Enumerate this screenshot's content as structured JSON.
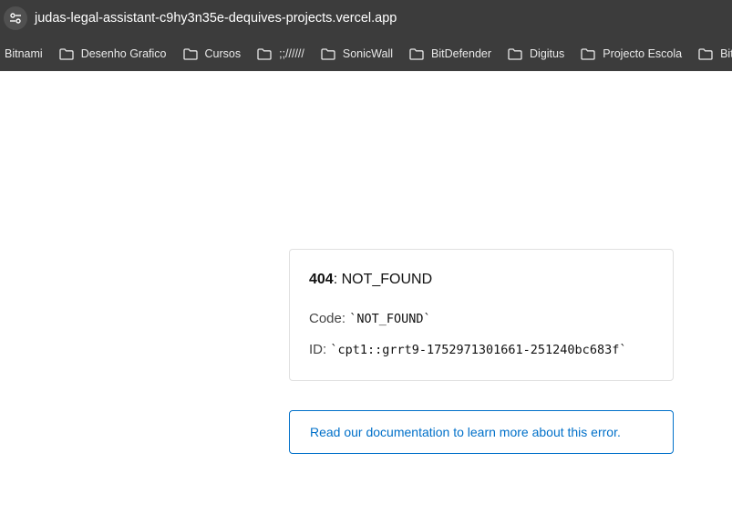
{
  "browser": {
    "url": "judas-legal-assistant-c9hy3n35e-dequives-projects.vercel.app",
    "bookmarks": [
      {
        "label": "Bitnami",
        "icon": "none"
      },
      {
        "label": "Desenho Grafico",
        "icon": "folder-icon"
      },
      {
        "label": "Cursos",
        "icon": "folder-icon"
      },
      {
        "label": ";;//////",
        "icon": "folder-icon"
      },
      {
        "label": "SonicWall",
        "icon": "folder-icon"
      },
      {
        "label": "BitDefender",
        "icon": "folder-icon"
      },
      {
        "label": "Digitus",
        "icon": "folder-icon"
      },
      {
        "label": "Projecto Escola",
        "icon": "folder-icon"
      },
      {
        "label": "BitCoi",
        "icon": "folder-icon"
      }
    ]
  },
  "error": {
    "status": "404",
    "message": ": NOT_FOUND",
    "code_label": "Code: ",
    "code_value": "`NOT_FOUND`",
    "id_label": "ID: ",
    "id_value": "`cpt1::grrt9-1752971301661-251240bc683f`"
  },
  "docs": {
    "link_text": "Read our documentation to learn more about this error."
  },
  "colors": {
    "browser_chrome": "#3c3c3c",
    "link": "#0070c9",
    "card_border": "#e0e0e0"
  }
}
